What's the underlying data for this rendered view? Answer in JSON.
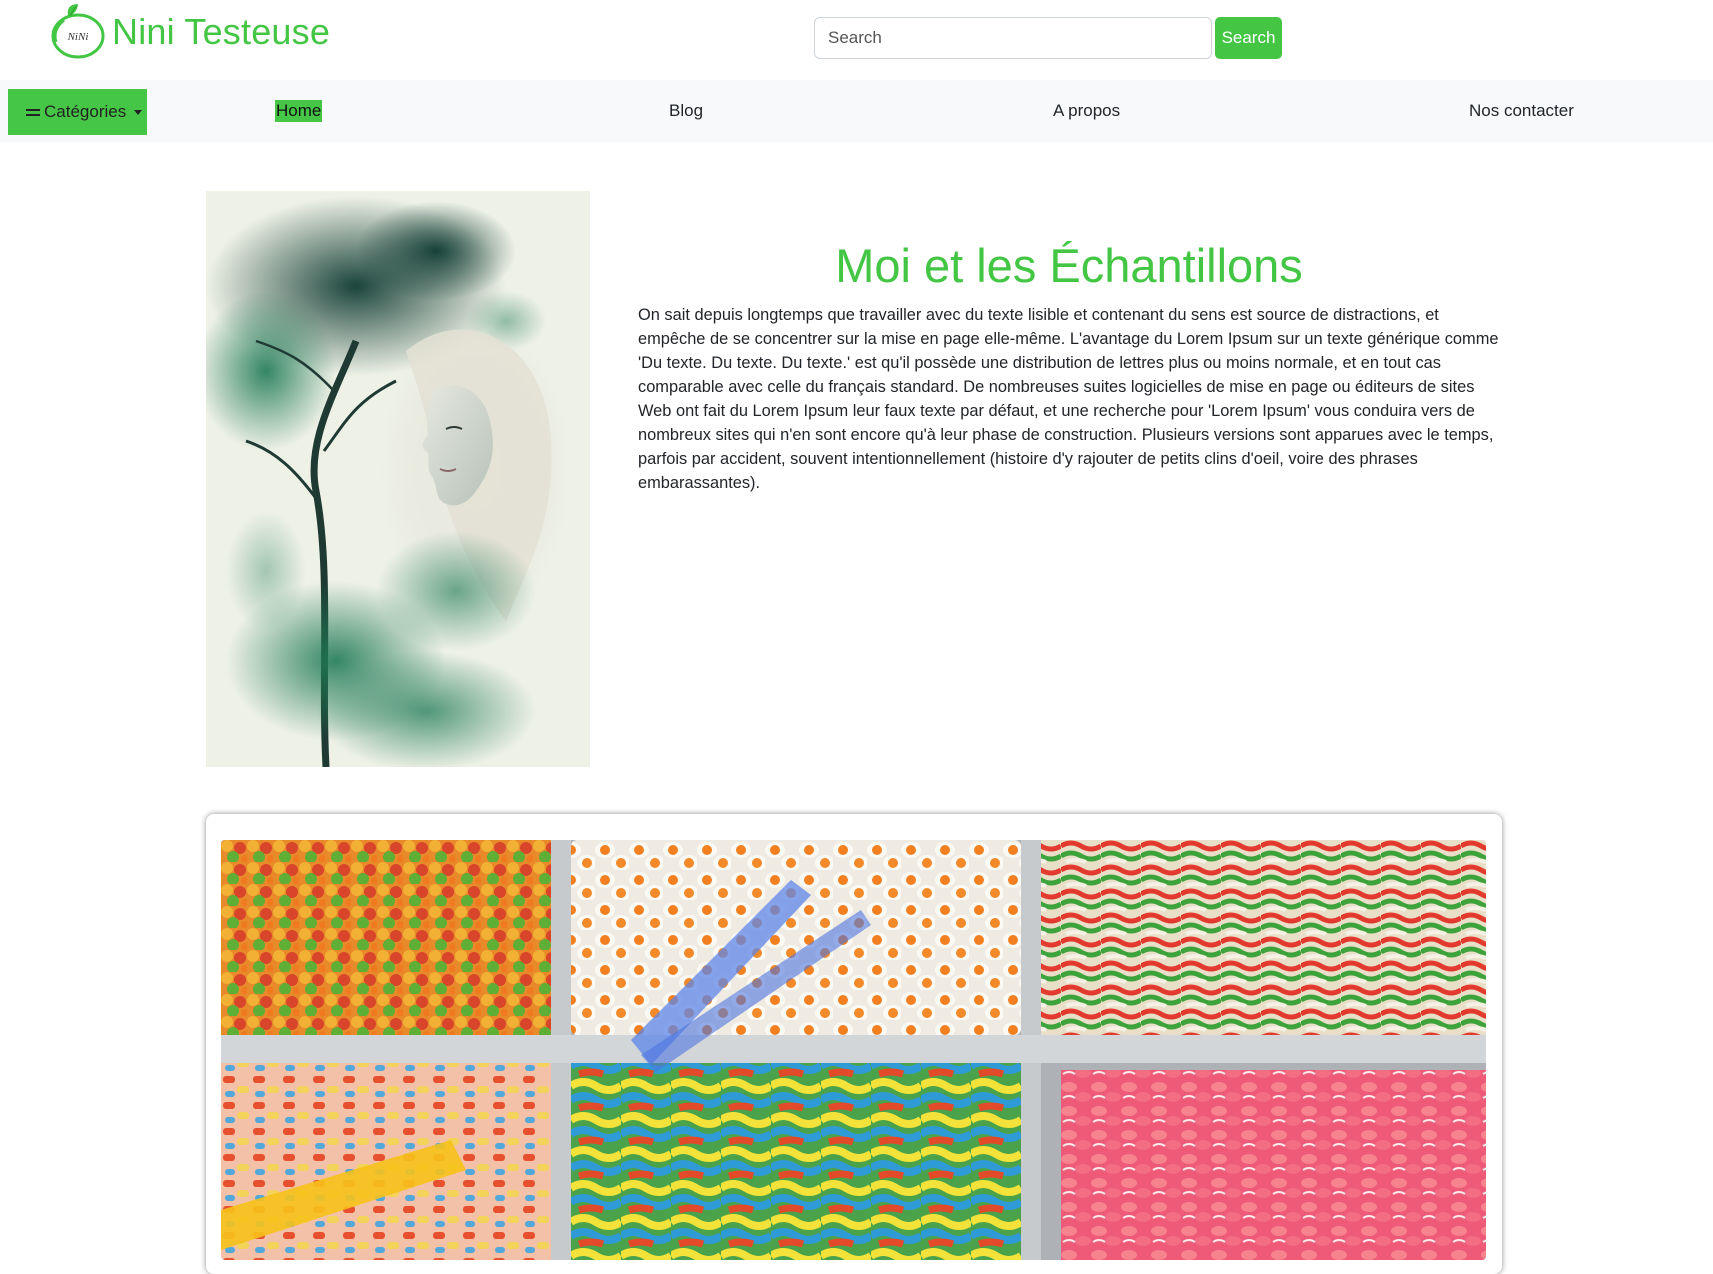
{
  "brand": {
    "logo_text": "NiNi",
    "name": "Nini Testeuse",
    "accent_color": "#43c643"
  },
  "search": {
    "placeholder": "Search",
    "button_label": "Search"
  },
  "nav": {
    "categories_label": "Catégories",
    "links": [
      {
        "label": "Home",
        "active": true
      },
      {
        "label": "Blog",
        "active": false
      },
      {
        "label": "A propos",
        "active": false
      },
      {
        "label": "Nos contacter",
        "active": false
      }
    ]
  },
  "intro": {
    "title": "Moi et les Échantillons",
    "text": "On sait depuis longtemps que travailler avec du texte lisible et contenant du sens est source de distractions, et empêche de se concentrer sur la mise en page elle-même. L'avantage du Lorem Ipsum sur un texte générique comme 'Du texte. Du texte. Du texte.' est qu'il possède une distribution de lettres plus ou moins normale, et en tout cas comparable avec celle du français standard. De nombreuses suites logicielles de mise en page ou éditeurs de sites Web ont fait du Lorem Ipsum leur faux texte par défaut, et une recherche pour 'Lorem Ipsum' vous conduira vers de nombreux sites qui n'en sont encore qu'à leur phase de construction. Plusieurs versions sont apparues avec le temps, parfois par accident, souvent intentionnellement (histoire d'y rajouter de petits clins d'oeil, voire des phrases embarassantes)."
  }
}
